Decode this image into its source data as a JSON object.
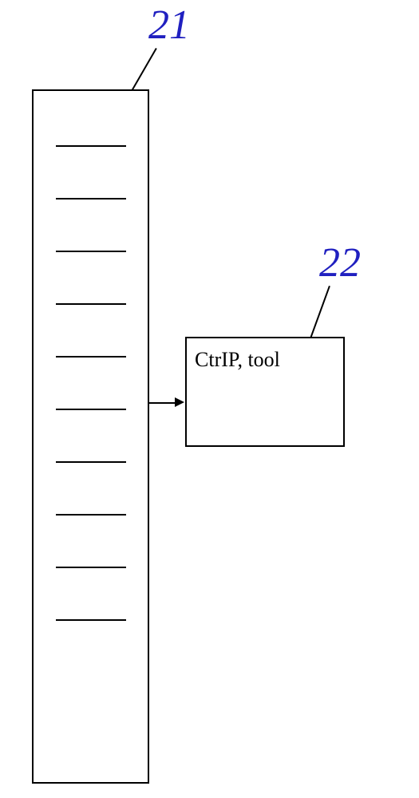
{
  "labels": {
    "column": "21",
    "tool": "22"
  },
  "tool_box": {
    "text": "CtrIP, tool"
  },
  "chart_data": {
    "type": "diagram",
    "elements": [
      {
        "id": "21",
        "role": "slot-column",
        "slot_lines": 10
      },
      {
        "id": "22",
        "role": "tool-box",
        "text": "CtrIP, tool"
      }
    ],
    "connections": [
      {
        "from": "21",
        "to": "22",
        "style": "arrow"
      }
    ],
    "callouts": [
      {
        "label": "21",
        "points_to": "slot-column"
      },
      {
        "label": "22",
        "points_to": "tool-box"
      }
    ]
  }
}
